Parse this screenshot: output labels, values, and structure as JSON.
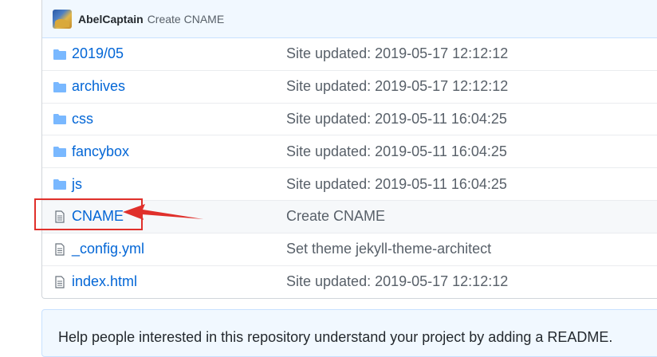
{
  "commit": {
    "author": "AbelCaptain",
    "message": "Create CNAME"
  },
  "files": [
    {
      "name": "2019/05",
      "type": "folder",
      "message": "Site updated: 2019-05-17 12:12:12"
    },
    {
      "name": "archives",
      "type": "folder",
      "message": "Site updated: 2019-05-17 12:12:12"
    },
    {
      "name": "css",
      "type": "folder",
      "message": "Site updated: 2019-05-11 16:04:25"
    },
    {
      "name": "fancybox",
      "type": "folder",
      "message": "Site updated: 2019-05-11 16:04:25"
    },
    {
      "name": "js",
      "type": "folder",
      "message": "Site updated: 2019-05-11 16:04:25"
    },
    {
      "name": "CNAME",
      "type": "file",
      "message": "Create CNAME"
    },
    {
      "name": "_config.yml",
      "type": "file",
      "message": "Set theme jekyll-theme-architect"
    },
    {
      "name": "index.html",
      "type": "file",
      "message": "Site updated: 2019-05-17 12:12:12"
    }
  ],
  "readme_prompt": "Help people interested in this repository understand your project by adding a README.",
  "colors": {
    "link": "#0366d6",
    "muted": "#586069",
    "header_bg": "#f1f8ff",
    "annotation": "#e0302b",
    "folder_icon": "#79b8ff"
  }
}
